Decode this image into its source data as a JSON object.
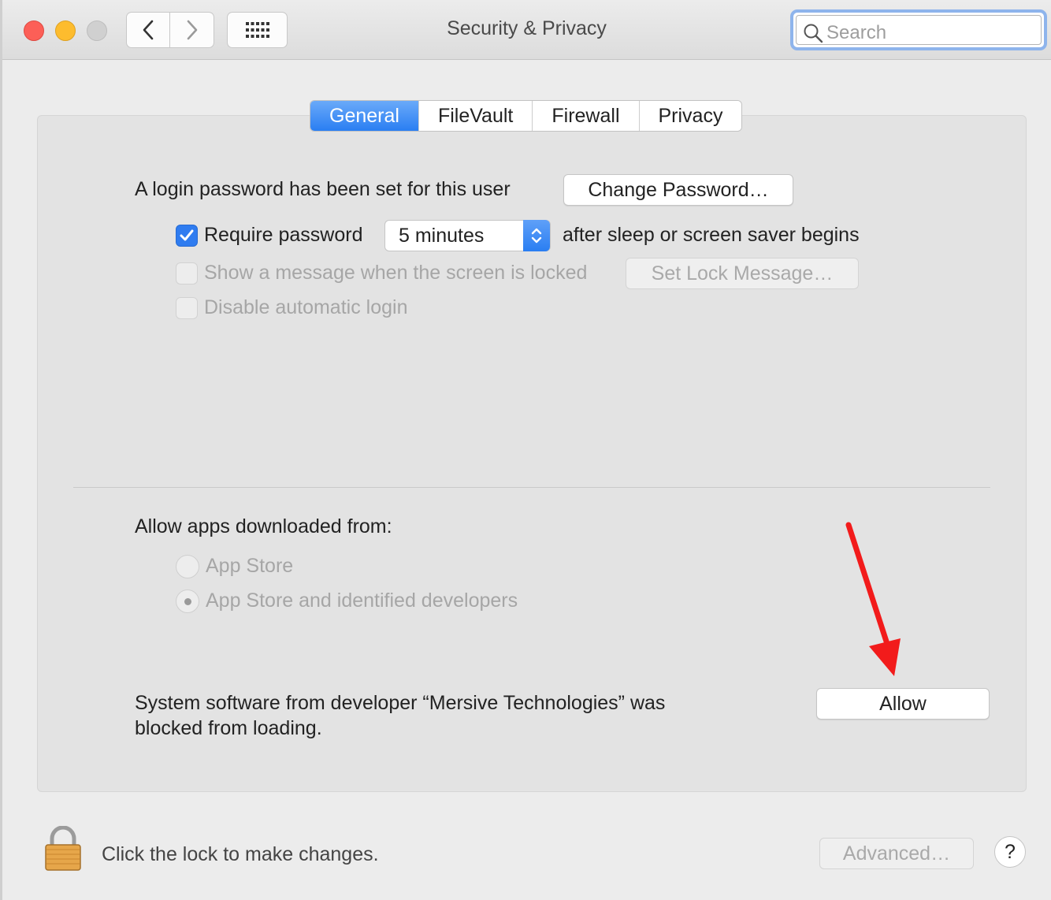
{
  "window": {
    "title": "Security & Privacy"
  },
  "toolbar": {
    "search_placeholder": "Search"
  },
  "tabs": [
    {
      "label": "General",
      "active": true
    },
    {
      "label": "FileVault",
      "active": false
    },
    {
      "label": "Firewall",
      "active": false
    },
    {
      "label": "Privacy",
      "active": false
    }
  ],
  "general": {
    "login_password_text": "A login password has been set for this user",
    "change_password_label": "Change Password…",
    "require_password_label": "Require password",
    "require_password_checked": true,
    "require_password_delay": "5 minutes",
    "after_sleep_text": "after sleep or screen saver begins",
    "show_message_label": "Show a message when the screen is locked",
    "set_lock_message_label": "Set Lock Message…",
    "disable_auto_login_label": "Disable automatic login"
  },
  "gatekeeper": {
    "heading": "Allow apps downloaded from:",
    "options": [
      {
        "label": "App Store",
        "selected": false
      },
      {
        "label": "App Store and identified developers",
        "selected": true
      }
    ],
    "blocked_message_line1": "System software from developer “Mersive Technologies” was",
    "blocked_message_line2": "blocked from loading.",
    "allow_label": "Allow"
  },
  "footer": {
    "lock_text": "Click the lock to make changes.",
    "advanced_label": "Advanced…",
    "help_label": "?"
  },
  "colors": {
    "accent": "#2a7ef2",
    "annotation_arrow": "#f21b1b"
  },
  "icons": [
    "back-chevron-icon",
    "forward-chevron-icon",
    "grid-icon",
    "search-icon",
    "checkmark-icon",
    "stepper-arrows-icon",
    "padlock-icon",
    "annotation-arrow"
  ]
}
